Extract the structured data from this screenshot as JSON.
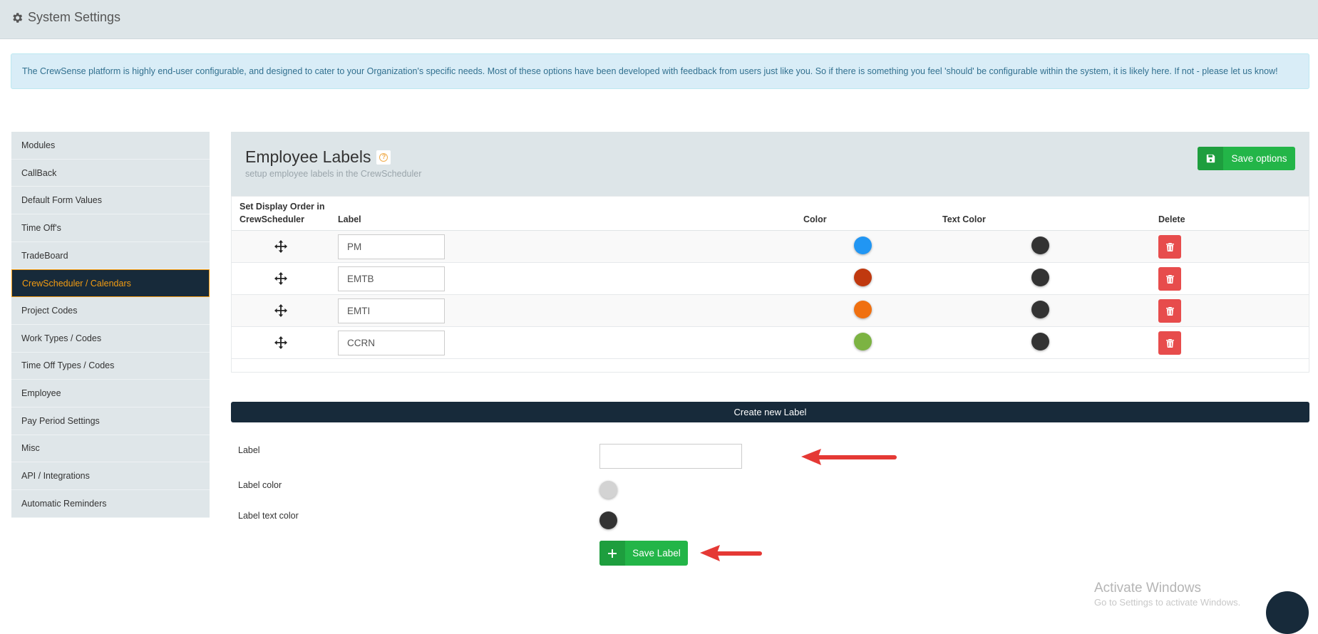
{
  "header": {
    "title": "System Settings",
    "icon": "gear-icon"
  },
  "info_text": "The CrewSense platform is highly end-user configurable, and designed to cater to your Organization's specific needs. Most of these options have been developed with feedback from users just like you. So if there is something you feel 'should' be configurable within the system, it is likely here. If not - please let us know!",
  "sidebar": {
    "active_index": 5,
    "items": [
      {
        "label": "Modules"
      },
      {
        "label": "CallBack"
      },
      {
        "label": "Default Form Values"
      },
      {
        "label": "Time Off's"
      },
      {
        "label": "TradeBoard"
      },
      {
        "label": "CrewScheduler / Calendars"
      },
      {
        "label": "Project Codes"
      },
      {
        "label": "Work Types / Codes"
      },
      {
        "label": "Time Off Types / Codes"
      },
      {
        "label": "Employee"
      },
      {
        "label": "Pay Period Settings"
      },
      {
        "label": "Misc"
      },
      {
        "label": "API / Integrations"
      },
      {
        "label": "Automatic Reminders"
      }
    ]
  },
  "panel": {
    "title": "Employee Labels",
    "subtitle": "setup employee labels in the CrewScheduler",
    "save_options_label": "Save options"
  },
  "table": {
    "headers": {
      "order_line1": "Set Display Order in",
      "order_line2": "CrewScheduler",
      "label": "Label",
      "color": "Color",
      "text_color": "Text Color",
      "delete": "Delete"
    },
    "rows": [
      {
        "label": "PM",
        "color": "#2196f3",
        "text_color": "#333333"
      },
      {
        "label": "EMTB",
        "color": "#c0390f",
        "text_color": "#333333"
      },
      {
        "label": "EMTI",
        "color": "#f07010",
        "text_color": "#333333"
      },
      {
        "label": "CCRN",
        "color": "#7cb342",
        "text_color": "#333333"
      }
    ]
  },
  "create": {
    "bar_label": "Create new Label",
    "label_field": "Label",
    "label_value": "",
    "label_color_field": "Label color",
    "label_color": "#d3d3d3",
    "label_text_color_field": "Label text color",
    "label_text_color": "#333333",
    "save_label": "Save Label"
  },
  "watermark": {
    "line1": "Activate Windows",
    "line2": "Go to Settings to activate Windows."
  },
  "colors": {
    "accent_green": "#23b548",
    "dark_navy": "#172a3a",
    "active_orange": "#f39c12",
    "danger": "#e74c4c",
    "arrow_red": "#e53935"
  }
}
